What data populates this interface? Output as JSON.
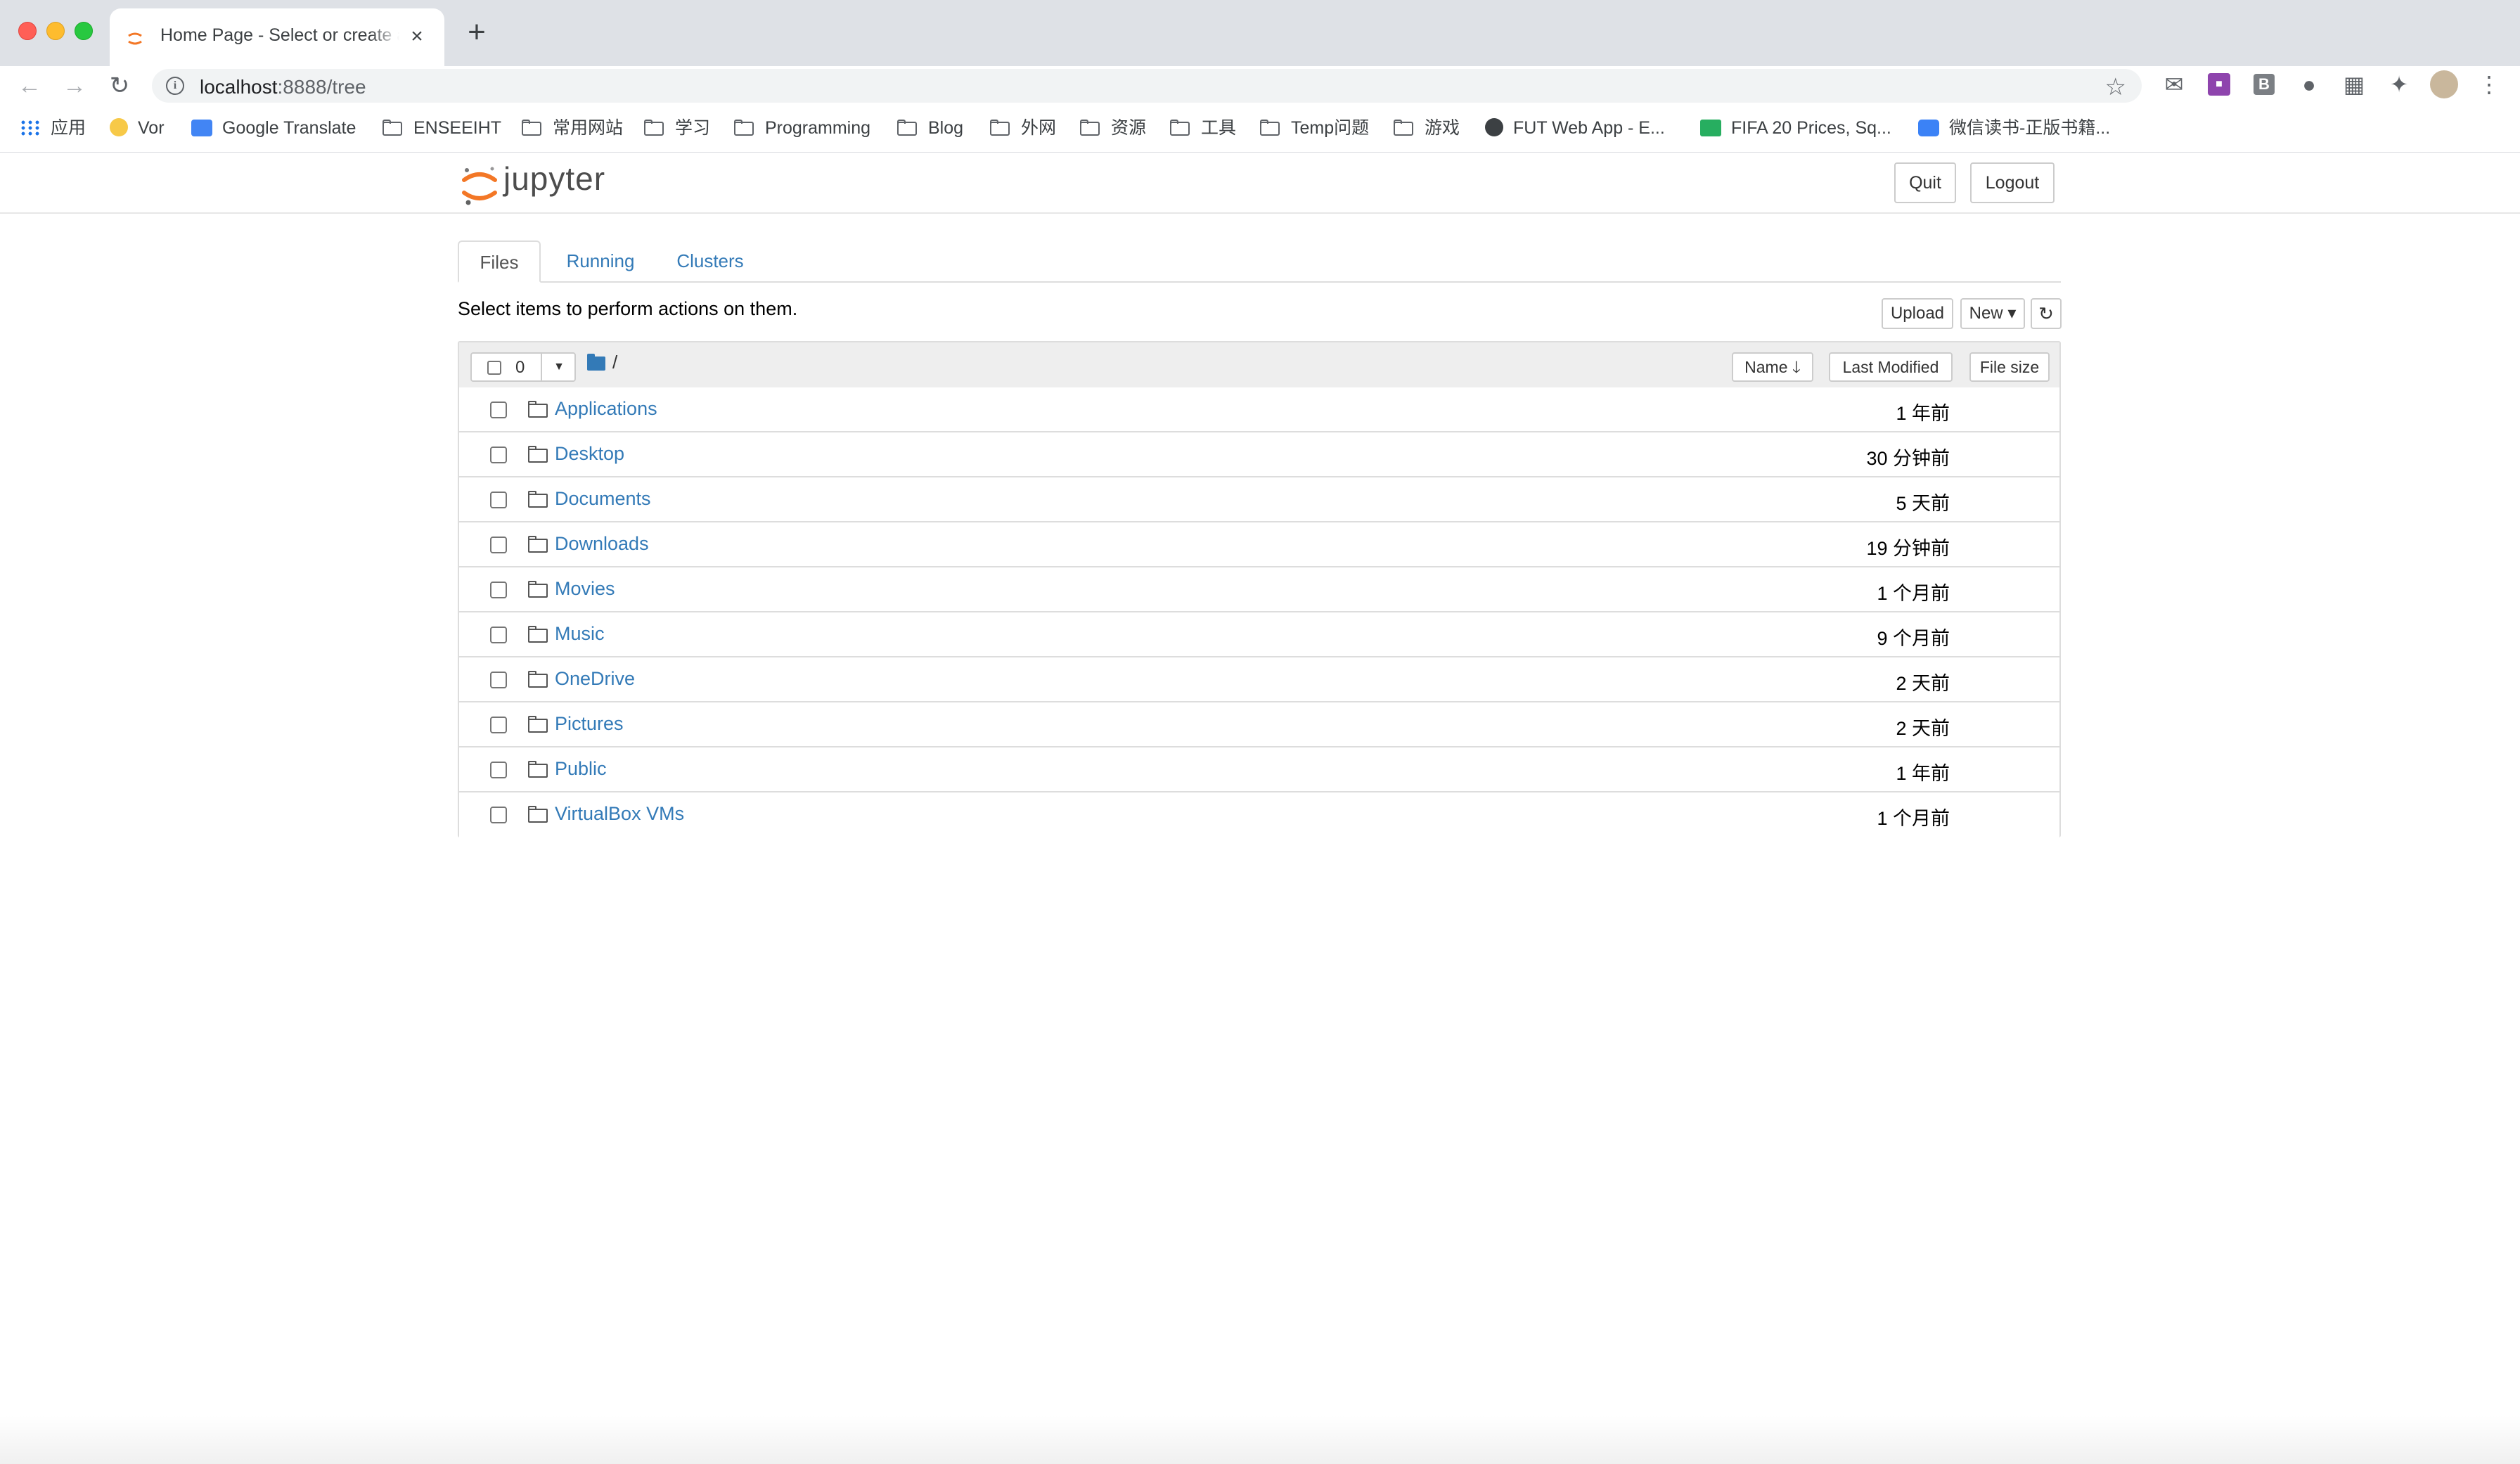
{
  "browser": {
    "tab_title": "Home Page - Select or create a notebook",
    "new_tab_label": "+",
    "url_host": "localhost",
    "url_path": ":8888/tree",
    "bookmarks": [
      {
        "label": "应用",
        "icon": "apps-grid-icon"
      },
      {
        "label": "Vor",
        "icon": "emoji-icon"
      },
      {
        "label": "Google Translate",
        "icon": "google-translate-icon"
      },
      {
        "label": "ENSEEIHT",
        "icon": "folder-icon"
      },
      {
        "label": "常用网站",
        "icon": "folder-icon"
      },
      {
        "label": "学习",
        "icon": "folder-icon"
      },
      {
        "label": "Programming",
        "icon": "folder-icon"
      },
      {
        "label": "Blog",
        "icon": "folder-icon"
      },
      {
        "label": "外网",
        "icon": "folder-icon"
      },
      {
        "label": "资源",
        "icon": "folder-icon"
      },
      {
        "label": "工具",
        "icon": "folder-icon"
      },
      {
        "label": "Temp问题",
        "icon": "folder-icon"
      },
      {
        "label": "游戏",
        "icon": "folder-icon"
      },
      {
        "label": "FUT Web App - E...",
        "icon": "globe-icon"
      },
      {
        "label": "FIFA 20 Prices, Sq...",
        "icon": "futbin-icon"
      },
      {
        "label": "微信读书-正版书籍...",
        "icon": "weread-icon"
      }
    ]
  },
  "jupyter": {
    "logo_text": "jupyter",
    "quit_label": "Quit",
    "logout_label": "Logout",
    "tabs": [
      "Files",
      "Running",
      "Clusters"
    ],
    "instructions": "Select items to perform actions on them.",
    "upload_label": "Upload",
    "new_label": "New",
    "refresh_icon": "refresh-icon",
    "selected_count": "0",
    "breadcrumb": "/",
    "sort_name": "Name",
    "sort_modified": "Last Modified",
    "sort_size": "File size",
    "items": [
      {
        "name": "Applications",
        "modified": "1 年前"
      },
      {
        "name": "Desktop",
        "modified": "30 分钟前"
      },
      {
        "name": "Documents",
        "modified": "5 天前"
      },
      {
        "name": "Downloads",
        "modified": "19 分钟前"
      },
      {
        "name": "Movies",
        "modified": "1 个月前"
      },
      {
        "name": "Music",
        "modified": "9 个月前"
      },
      {
        "name": "OneDrive",
        "modified": "2 天前"
      },
      {
        "name": "Pictures",
        "modified": "2 天前"
      },
      {
        "name": "Public",
        "modified": "1 年前"
      },
      {
        "name": "VirtualBox VMs",
        "modified": "1 个月前"
      }
    ]
  },
  "colors": {
    "accent_link": "#337ab7",
    "jupyter_orange": "#f37726"
  }
}
